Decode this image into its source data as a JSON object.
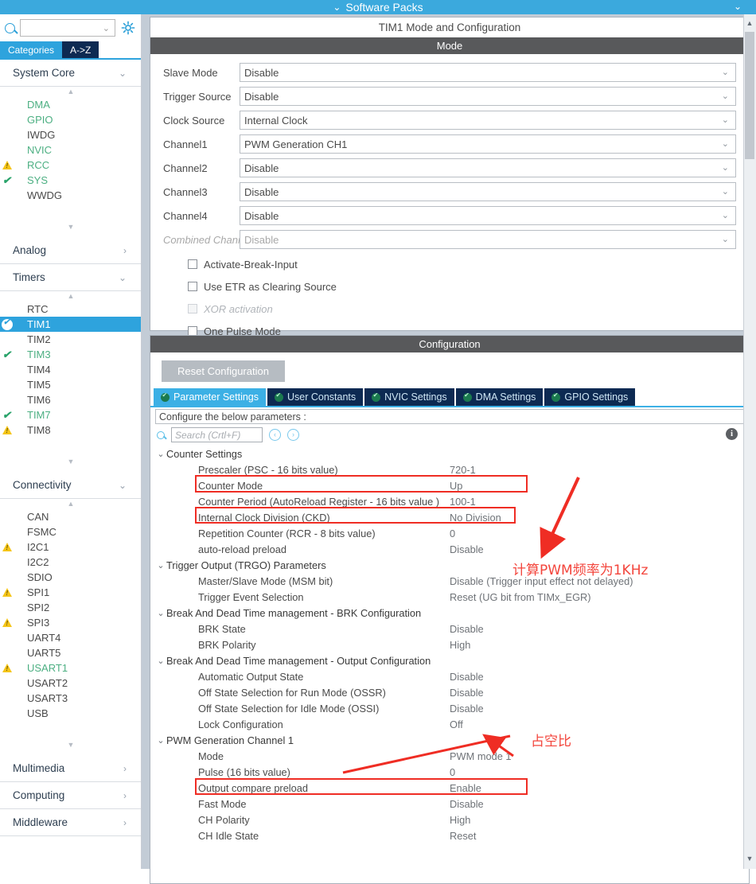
{
  "topbar": {
    "software_packs": "Software Packs",
    "chevron": "⌄"
  },
  "sidebar": {
    "search_placeholder": "",
    "tabs": {
      "categories": "Categories",
      "a_to_z": "A->Z"
    },
    "groups": [
      {
        "name": "System Core",
        "caret": "⌄",
        "expanded": true,
        "items": [
          {
            "label": "DMA",
            "status": "none",
            "color": "green"
          },
          {
            "label": "GPIO",
            "status": "none",
            "color": "green"
          },
          {
            "label": "IWDG",
            "status": "none",
            "color": "default"
          },
          {
            "label": "NVIC",
            "status": "none",
            "color": "green"
          },
          {
            "label": "RCC",
            "status": "warning",
            "color": "green"
          },
          {
            "label": "SYS",
            "status": "check",
            "color": "green"
          },
          {
            "label": "WWDG",
            "status": "none",
            "color": "default"
          }
        ]
      },
      {
        "name": "Analog",
        "caret": "›",
        "expanded": false,
        "items": []
      },
      {
        "name": "Timers",
        "caret": "⌄",
        "expanded": true,
        "items": [
          {
            "label": "RTC",
            "status": "none",
            "color": "default"
          },
          {
            "label": "TIM1",
            "status": "selected",
            "color": "selected"
          },
          {
            "label": "TIM2",
            "status": "none",
            "color": "default"
          },
          {
            "label": "TIM3",
            "status": "check",
            "color": "green"
          },
          {
            "label": "TIM4",
            "status": "none",
            "color": "default"
          },
          {
            "label": "TIM5",
            "status": "none",
            "color": "default"
          },
          {
            "label": "TIM6",
            "status": "none",
            "color": "default"
          },
          {
            "label": "TIM7",
            "status": "check",
            "color": "green"
          },
          {
            "label": "TIM8",
            "status": "warning",
            "color": "default"
          }
        ]
      },
      {
        "name": "Connectivity",
        "caret": "⌄",
        "expanded": true,
        "items": [
          {
            "label": "CAN",
            "status": "none",
            "color": "default"
          },
          {
            "label": "FSMC",
            "status": "none",
            "color": "default"
          },
          {
            "label": "I2C1",
            "status": "warning",
            "color": "default"
          },
          {
            "label": "I2C2",
            "status": "none",
            "color": "default"
          },
          {
            "label": "SDIO",
            "status": "none",
            "color": "default"
          },
          {
            "label": "SPI1",
            "status": "warning",
            "color": "default"
          },
          {
            "label": "SPI2",
            "status": "none",
            "color": "default"
          },
          {
            "label": "SPI3",
            "status": "warning",
            "color": "default"
          },
          {
            "label": "UART4",
            "status": "none",
            "color": "default"
          },
          {
            "label": "UART5",
            "status": "none",
            "color": "default"
          },
          {
            "label": "USART1",
            "status": "warning",
            "color": "green"
          },
          {
            "label": "USART2",
            "status": "none",
            "color": "default"
          },
          {
            "label": "USART3",
            "status": "none",
            "color": "default"
          },
          {
            "label": "USB",
            "status": "none",
            "color": "default"
          }
        ]
      },
      {
        "name": "Multimedia",
        "caret": "›",
        "expanded": false,
        "items": []
      },
      {
        "name": "Computing",
        "caret": "›",
        "expanded": false,
        "items": []
      },
      {
        "name": "Middleware",
        "caret": "›",
        "expanded": false,
        "items": []
      }
    ]
  },
  "mode_panel": {
    "title": "TIM1 Mode and Configuration",
    "band": "Mode",
    "dropdown_arrow": "⌄",
    "rows": [
      {
        "label": "Slave Mode",
        "value": "Disable",
        "disabled": false
      },
      {
        "label": "Trigger Source",
        "value": "Disable",
        "disabled": false
      },
      {
        "label": "Clock Source",
        "value": "Internal Clock",
        "disabled": false
      },
      {
        "label": "Channel1",
        "value": "PWM Generation CH1",
        "disabled": false
      },
      {
        "label": "Channel2",
        "value": "Disable",
        "disabled": false
      },
      {
        "label": "Channel3",
        "value": "Disable",
        "disabled": false
      },
      {
        "label": "Channel4",
        "value": "Disable",
        "disabled": false
      },
      {
        "label": "Combined Channels",
        "value": "Disable",
        "disabled": true
      }
    ],
    "checkboxes": [
      {
        "label": "Activate-Break-Input",
        "checked": false,
        "disabled": false
      },
      {
        "label": "Use ETR as Clearing Source",
        "checked": false,
        "disabled": false
      },
      {
        "label": "XOR activation",
        "checked": false,
        "disabled": true
      },
      {
        "label": "One Pulse Mode",
        "checked": false,
        "disabled": false
      }
    ]
  },
  "config_panel": {
    "band": "Configuration",
    "reset_button": "Reset Configuration",
    "tabs": [
      {
        "label": "Parameter Settings",
        "active": true
      },
      {
        "label": "User Constants",
        "active": false
      },
      {
        "label": "NVIC Settings",
        "active": false
      },
      {
        "label": "DMA Settings",
        "active": false
      },
      {
        "label": "GPIO Settings",
        "active": false
      }
    ],
    "configure_text": "Configure the below parameters :",
    "search_placeholder": "Search (Crtl+F)",
    "nav_prev": "‹",
    "nav_next": "›",
    "info_glyph": "i",
    "tree": [
      {
        "type": "group",
        "label": "Counter Settings",
        "caret": "⌄"
      },
      {
        "type": "param",
        "label": "Prescaler (PSC - 16 bits value)",
        "value": "720-1"
      },
      {
        "type": "param",
        "label": "Counter Mode",
        "value": "Up"
      },
      {
        "type": "param",
        "label": "Counter Period (AutoReload Register - 16 bits value )",
        "value": "100-1"
      },
      {
        "type": "param",
        "label": "Internal Clock Division (CKD)",
        "value": "No Division"
      },
      {
        "type": "param",
        "label": "Repetition Counter (RCR - 8 bits value)",
        "value": "0"
      },
      {
        "type": "param",
        "label": "auto-reload preload",
        "value": "Disable"
      },
      {
        "type": "group",
        "label": "Trigger Output (TRGO) Parameters",
        "caret": "⌄"
      },
      {
        "type": "param",
        "label": "Master/Slave Mode (MSM bit)",
        "value": "Disable (Trigger input effect not delayed)"
      },
      {
        "type": "param",
        "label": "Trigger Event Selection",
        "value": "Reset (UG bit from TIMx_EGR)"
      },
      {
        "type": "group",
        "label": "Break And Dead Time management - BRK Configuration",
        "caret": "⌄"
      },
      {
        "type": "param",
        "label": "BRK State",
        "value": "Disable"
      },
      {
        "type": "param",
        "label": "BRK Polarity",
        "value": "High"
      },
      {
        "type": "group",
        "label": "Break And Dead Time management - Output Configuration",
        "caret": "⌄"
      },
      {
        "type": "param",
        "label": "Automatic Output State",
        "value": "Disable"
      },
      {
        "type": "param",
        "label": "Off State Selection for Run Mode (OSSR)",
        "value": "Disable"
      },
      {
        "type": "param",
        "label": "Off State Selection for Idle Mode (OSSI)",
        "value": "Disable"
      },
      {
        "type": "param",
        "label": "Lock Configuration",
        "value": "Off"
      },
      {
        "type": "group",
        "label": "PWM Generation Channel 1",
        "caret": "⌄"
      },
      {
        "type": "param",
        "label": "Mode",
        "value": "PWM mode 1"
      },
      {
        "type": "param",
        "label": "Pulse (16 bits value)",
        "value": "0"
      },
      {
        "type": "param",
        "label": "Output compare preload",
        "value": "Enable"
      },
      {
        "type": "param",
        "label": "Fast Mode",
        "value": "Disable"
      },
      {
        "type": "param",
        "label": "CH Polarity",
        "value": "High"
      },
      {
        "type": "param",
        "label": "CH Idle State",
        "value": "Reset"
      }
    ]
  },
  "annotations": {
    "note_frequency": "计算PWM频率为1KHz",
    "note_duty": "占空比",
    "color": "#ef2d24"
  }
}
